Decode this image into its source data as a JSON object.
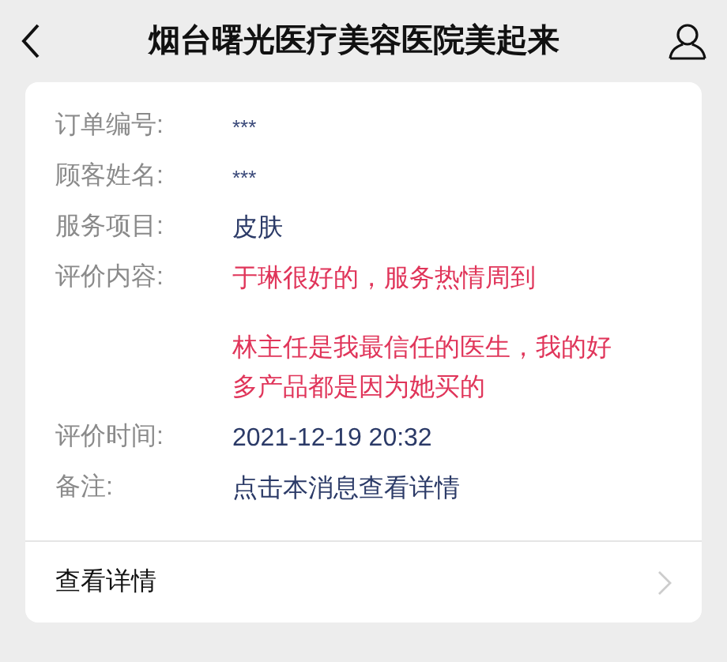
{
  "header": {
    "title": "烟台曙光医疗美容医院美起来"
  },
  "fields": [
    {
      "label": "订单编号:",
      "kind": "masked",
      "paragraphs": [
        "***"
      ]
    },
    {
      "label": "顾客姓名:",
      "kind": "masked",
      "paragraphs": [
        "***"
      ]
    },
    {
      "label": "服务项目:",
      "kind": "text",
      "paragraphs": [
        "皮肤"
      ]
    },
    {
      "label": "评价内容:",
      "kind": "highlight",
      "paragraphs": [
        "于琳很好的，服务热情周到",
        "林主任是我最信任的医生，我的好多产品都是因为她买的"
      ]
    },
    {
      "label": "评价时间:",
      "kind": "text",
      "paragraphs": [
        "2021-12-19 20:32"
      ]
    },
    {
      "label": "备注:",
      "kind": "text",
      "paragraphs": [
        "点击本消息查看详情"
      ]
    }
  ],
  "footer": {
    "link": "查看详情"
  }
}
